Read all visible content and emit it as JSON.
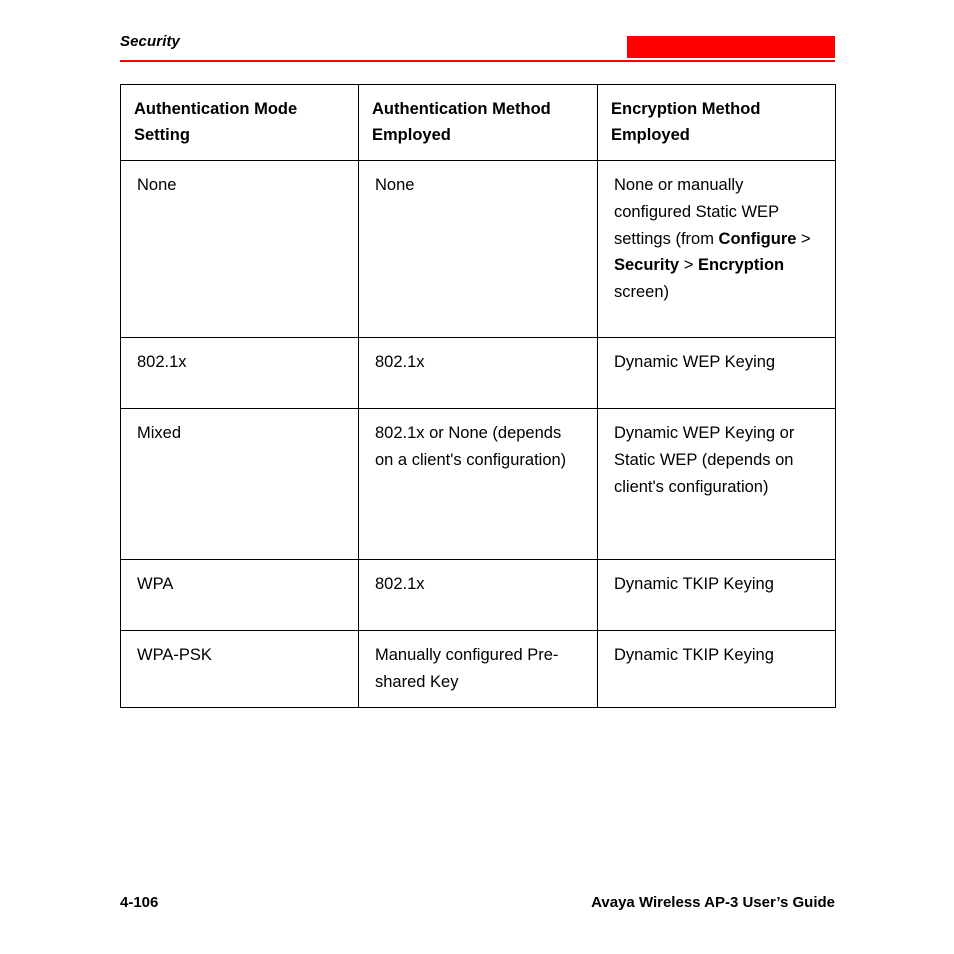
{
  "header": {
    "title": "Security",
    "accent_color": "#ff0000",
    "rule_color": "#ff0000"
  },
  "table": {
    "columns": [
      "Authentication Mode Setting",
      "Authentication Method Employed",
      "Encryption Method Employed"
    ],
    "rows": [
      {
        "mode": "None",
        "method": "None",
        "encryption_prefix": "None or manually configured Static WEP settings (from ",
        "encryption_bold_1": "Configure",
        "encryption_sep_1": " > ",
        "encryption_bold_2": "Security",
        "encryption_sep_2": " > ",
        "encryption_bold_3": "Encryption",
        "encryption_suffix": " screen)"
      },
      {
        "mode": "802.1x",
        "method": "802.1x",
        "encryption": "Dynamic WEP Keying"
      },
      {
        "mode": "Mixed",
        "method": "802.1x or None (depends on a client's configuration)",
        "encryption": "Dynamic WEP Keying or Static WEP (depends on client's configuration)"
      },
      {
        "mode": "WPA",
        "method": "802.1x",
        "encryption": "Dynamic TKIP Keying"
      },
      {
        "mode": "WPA-PSK",
        "method": "Manually configured Pre-shared Key",
        "encryption": "Dynamic TKIP Keying"
      }
    ]
  },
  "footer": {
    "page_number": "4-106",
    "guide_title": "Avaya Wireless AP-3 User’s Guide"
  }
}
